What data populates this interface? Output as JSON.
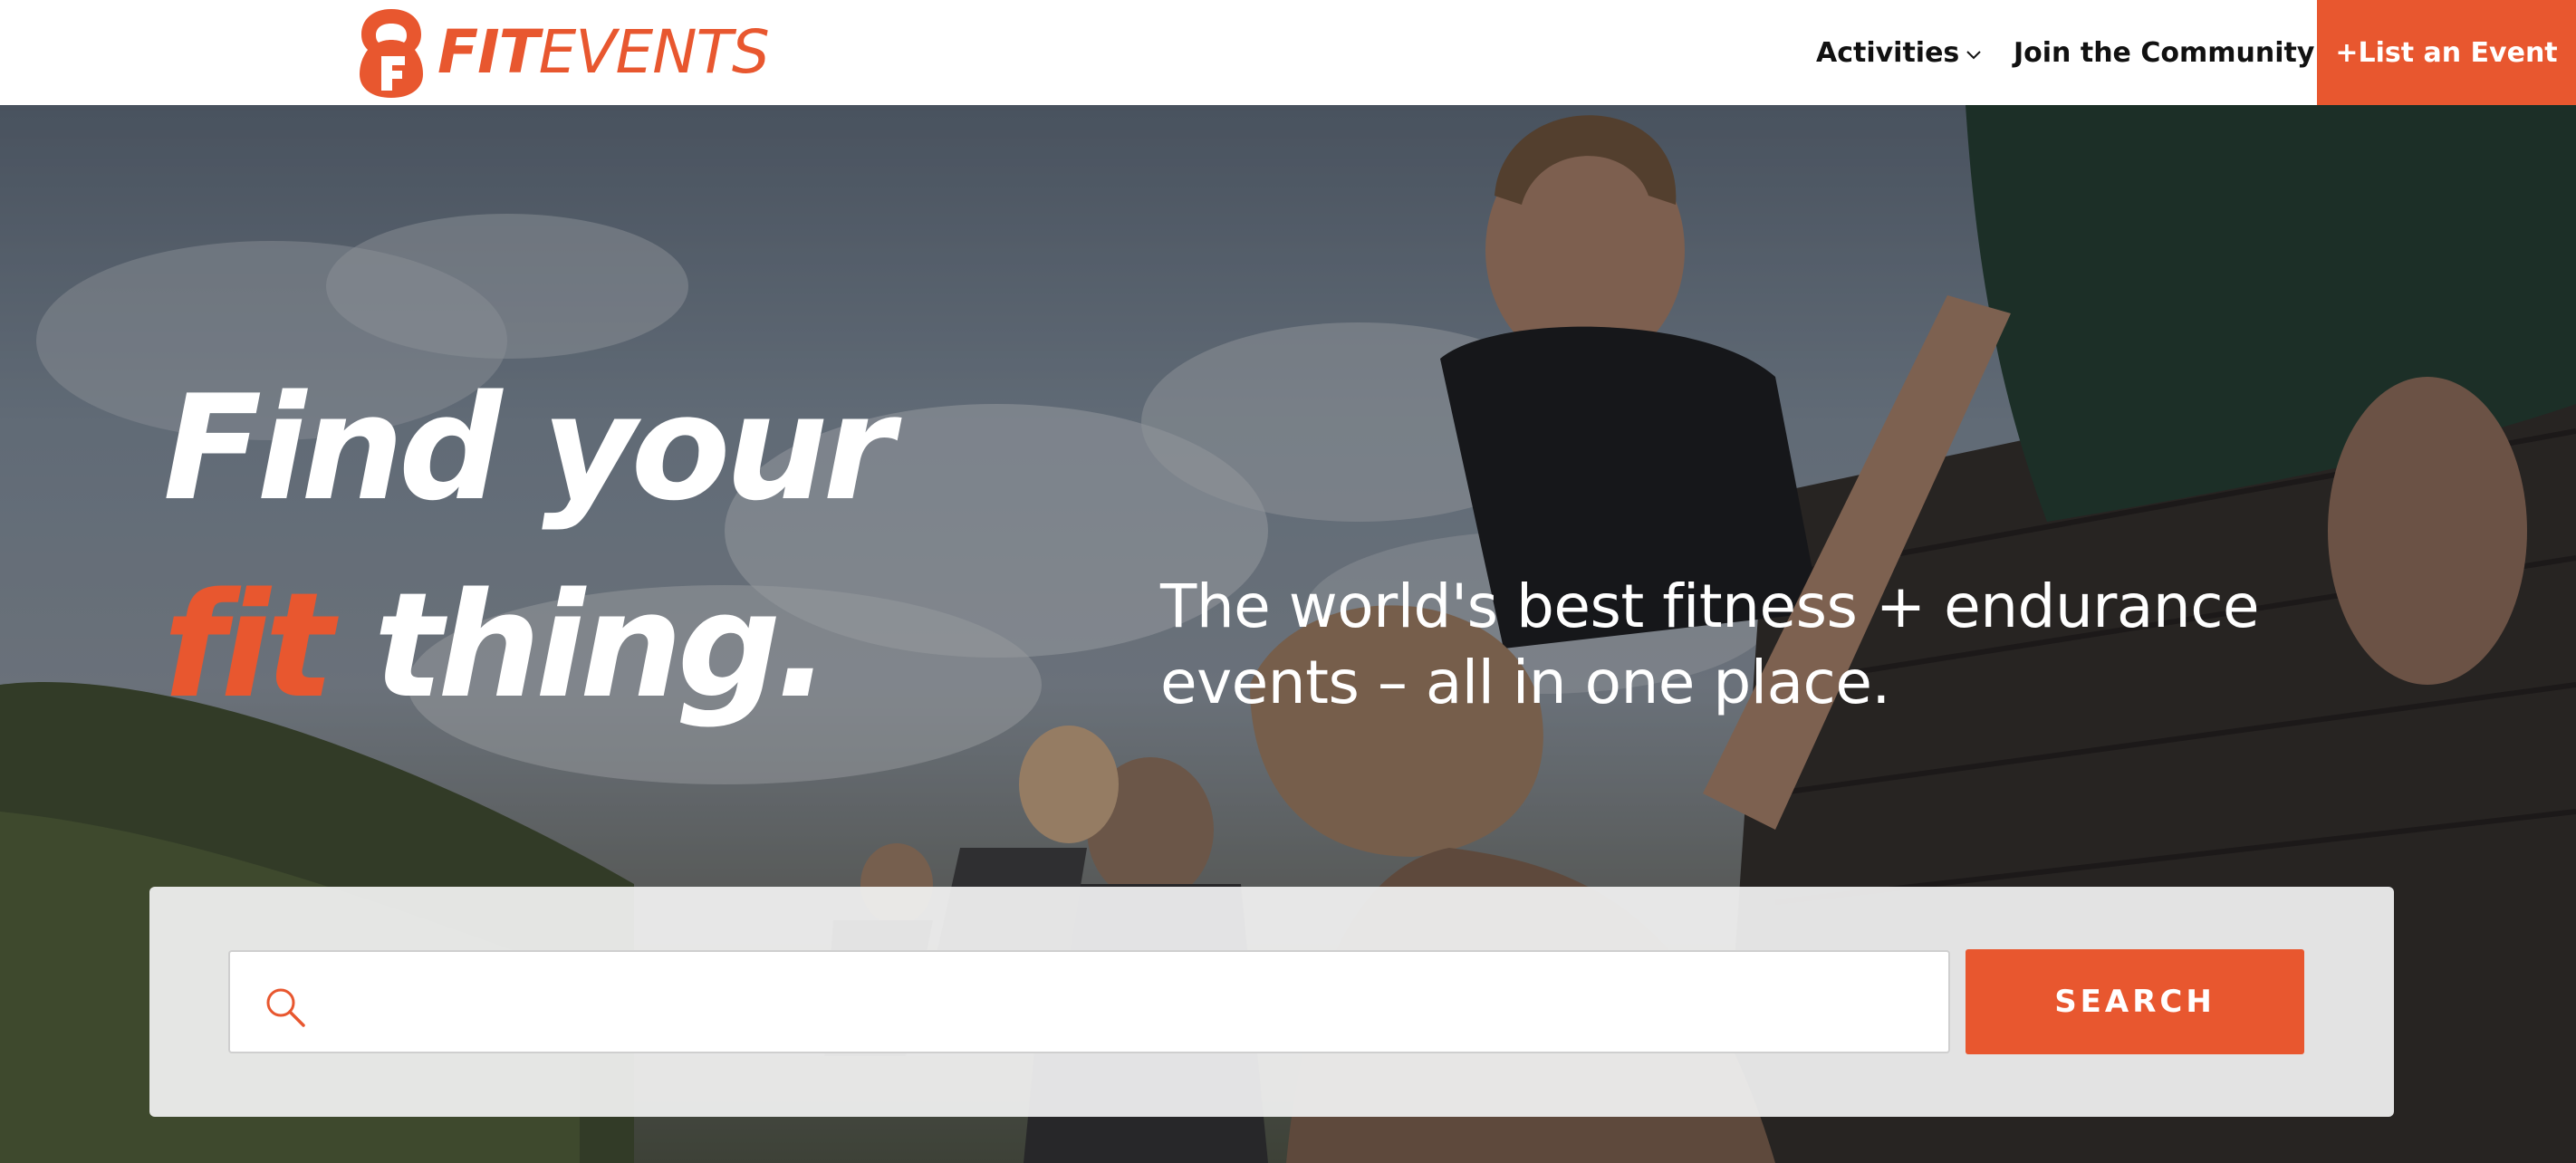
{
  "brand": {
    "name_part1": "FIT",
    "name_part2": "EVENTS",
    "accent_color": "#e8572f"
  },
  "nav": {
    "activities_label": "Activities",
    "community_label": "Join the Community",
    "list_event_label": "+List an Event"
  },
  "hero": {
    "headline_word1": "Find",
    "headline_word2": "your",
    "headline_word3": "fit",
    "headline_word4": "thing.",
    "subtitle": "The world's best fitness + endurance events – all in one place."
  },
  "search": {
    "placeholder": "",
    "value": "",
    "button_label": "SEARCH"
  },
  "icons": {
    "logo": "kettlebell-f-logo-icon",
    "dropdown": "chevron-down-icon",
    "search": "search-icon"
  }
}
